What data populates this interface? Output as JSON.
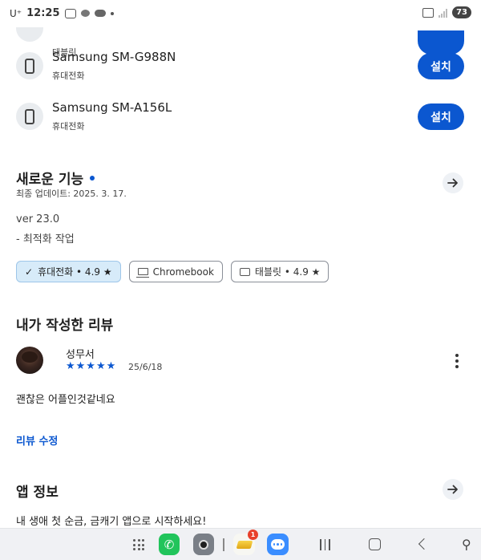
{
  "status_bar": {
    "carrier": "U⁺",
    "time": "12:25",
    "battery": "73"
  },
  "devices": [
    {
      "name": "",
      "type": "태블릿",
      "button": ""
    },
    {
      "name": "Samsung SM-G988N",
      "type": "휴대전화",
      "button": "설치"
    },
    {
      "name": "Samsung SM-A156L",
      "type": "휴대전화",
      "button": "설치"
    }
  ],
  "whats_new": {
    "title": "새로운 기능",
    "updated": "최종 업데이트: 2025. 3. 17.",
    "version": "ver 23.0",
    "notes": "- 최적화 작업"
  },
  "chips": [
    {
      "label": "휴대전화 • 4.9 ★",
      "icon": "check-icon",
      "selected": true
    },
    {
      "label": "Chromebook",
      "icon": "laptop-icon",
      "selected": false
    },
    {
      "label": "태블릿 • 4.9 ★",
      "icon": "tablet-icon",
      "selected": false
    }
  ],
  "review": {
    "section_title": "내가 작성한 리뷰",
    "reviewer": "성무서",
    "stars": "★★★★★",
    "rating": 5,
    "date": "25/6/18",
    "text": "괜찮은 어플인것같네요",
    "edit_label": "리뷰 수정"
  },
  "app_info": {
    "title": "앱 정보",
    "text": "내 생애 첫 순금, 금캐기 앱으로 시작하세요!"
  },
  "taskbar": {
    "notification_count": "1",
    "phone_glyph": "✆",
    "accessibility_glyph": "⚲"
  },
  "colors": {
    "accent": "#0b57d0",
    "chip_selected": "#d7ebf9",
    "taskbar_bg": "#f0f1f4"
  }
}
